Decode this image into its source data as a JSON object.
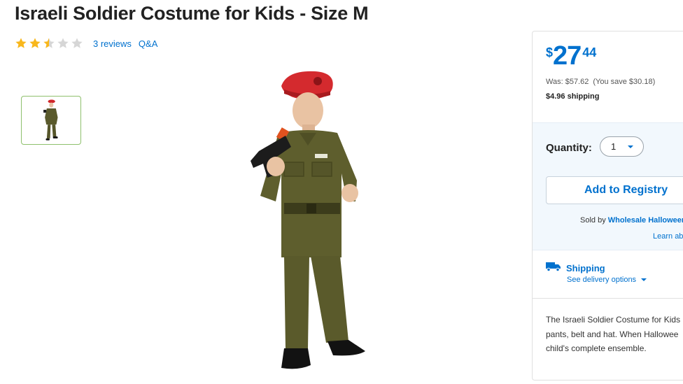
{
  "product": {
    "title": "Israeli Soldier Costume for Kids - Size M",
    "rating_value": 2.5,
    "rating_max": 5,
    "reviews_link": "3 reviews",
    "qa_link": "Q&A",
    "thumbnail_count": 1
  },
  "pricing": {
    "currency_symbol": "$",
    "dollars": "27",
    "cents": "44",
    "was": "Was: $57.62",
    "savings": "(You save $30.18)",
    "shipping_cost": "$4.96 shipping"
  },
  "purchase": {
    "quantity_label": "Quantity:",
    "quantity_value": "1",
    "registry_button": "Add to Registry",
    "sold_by_prefix": "Sold by",
    "seller_name": "Wholesale Halloween",
    "learn_more": "Learn abo"
  },
  "shipping": {
    "label": "Shipping",
    "delivery_options": "See delivery options"
  },
  "description": {
    "lines": [
      "The Israeli Soldier Costume for Kids",
      "pants, belt and hat. When Hallowee",
      "child's complete ensemble."
    ]
  },
  "colors": {
    "accent_blue": "#0071ce",
    "star_gold": "#f8b71c",
    "star_empty": "#d6d6d6",
    "thumb_border": "#8ec06c"
  },
  "icons": {
    "star": "star-icon",
    "caret": "caret-down-icon",
    "truck": "truck-icon"
  }
}
